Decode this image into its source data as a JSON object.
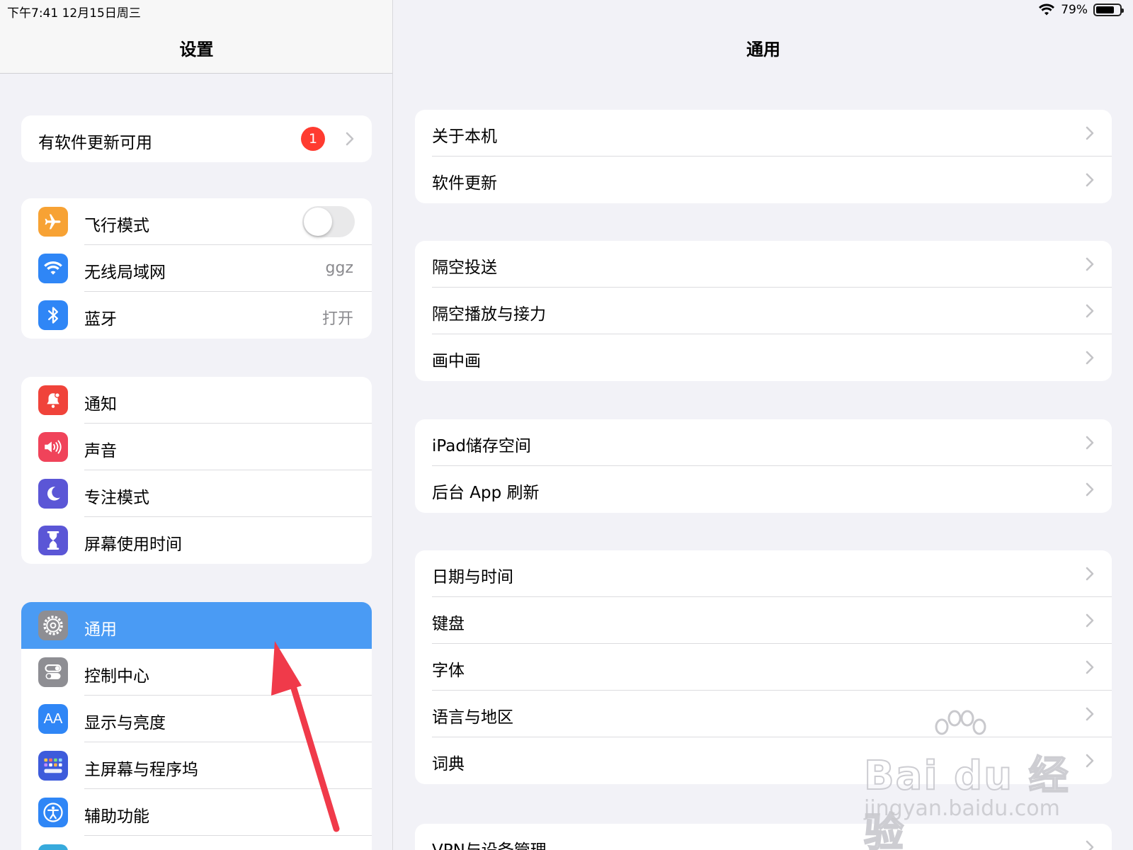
{
  "status_bar": {
    "time": "下午7:41   12月15日周三",
    "battery": "79%",
    "battery_level": 0.79
  },
  "sidebar": {
    "title": "设置",
    "update_row": {
      "label": "有软件更新可用",
      "badge": "1"
    },
    "connectivity": [
      {
        "label": "飞行模式",
        "icon": "airplane-icon",
        "color": "#f7a234",
        "toggle": false
      },
      {
        "label": "无线局域网",
        "icon": "wifi-icon",
        "color": "#2f86f6",
        "value": "ggz"
      },
      {
        "label": "蓝牙",
        "icon": "bluetooth-icon",
        "color": "#2f86f6",
        "value": "打开"
      }
    ],
    "notifications": [
      {
        "label": "通知",
        "icon": "bell-icon",
        "color": "#f0433a"
      },
      {
        "label": "声音",
        "icon": "speaker-icon",
        "color": "#f0435a"
      },
      {
        "label": "专注模式",
        "icon": "moon-icon",
        "color": "#5b56d6"
      },
      {
        "label": "屏幕使用时间",
        "icon": "hourglass-icon",
        "color": "#5b56d6"
      }
    ],
    "general": [
      {
        "label": "通用",
        "icon": "gear-icon",
        "color": "#8e8e93",
        "selected": true
      },
      {
        "label": "控制中心",
        "icon": "toggles-icon",
        "color": "#8e8e93"
      },
      {
        "label": "显示与亮度",
        "icon": "text-size-icon",
        "color": "#2f86f6"
      },
      {
        "label": "主屏幕与程序坞",
        "icon": "grid-icon",
        "color": "#3d5bdb"
      },
      {
        "label": "辅助功能",
        "icon": "accessibility-icon",
        "color": "#2f86f6"
      }
    ]
  },
  "detail": {
    "title": "通用",
    "groups": [
      [
        "关于本机",
        "软件更新"
      ],
      [
        "隔空投送",
        "隔空播放与接力",
        "画中画"
      ],
      [
        "iPad储存空间",
        "后台 App 刷新"
      ],
      [
        "日期与时间",
        "键盘",
        "字体",
        "语言与地区",
        "词典"
      ],
      [
        "VPN与设备管理"
      ]
    ]
  },
  "watermark": {
    "main": "Bai du 经验",
    "sub": "jingyan.baidu.com"
  },
  "colors": {
    "accent": "#4a9bf4",
    "badge": "#ff3b30",
    "arrow": "#f03a4a"
  }
}
